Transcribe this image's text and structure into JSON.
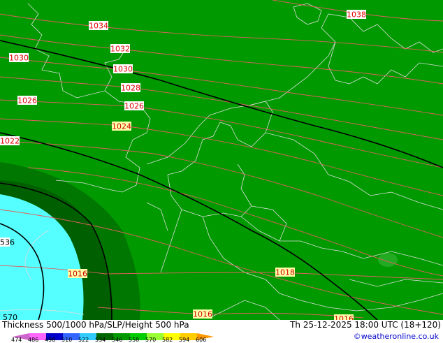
{
  "map": {
    "isobar_labels": [
      {
        "text": "1038"
      },
      {
        "text": "1034"
      },
      {
        "text": "1032"
      },
      {
        "text": "1030"
      },
      {
        "text": "1030"
      },
      {
        "text": "1028"
      },
      {
        "text": "1026"
      },
      {
        "text": "1026"
      },
      {
        "text": "1024"
      },
      {
        "text": "1022"
      },
      {
        "text": "1018"
      },
      {
        "text": "1016"
      },
      {
        "text": "1016"
      },
      {
        "text": "1016"
      }
    ],
    "thickness_labels": [
      "536",
      "570"
    ],
    "colors": {
      "land_green": "#009a00",
      "dark_green": "#007700",
      "darker_green": "#005f00",
      "cyan": "#55ffff",
      "isobar": "#e06060",
      "border": "#dddddd",
      "height_line": "#000000"
    }
  },
  "footer": {
    "title": "Thickness 500/1000 hPa/SLP/Height 500 hPa",
    "datetime": "Th 25-12-2025 18:00 UTC (18+120)",
    "credit": "©weatheronline.co.uk",
    "scale": {
      "labels": [
        "474",
        "486",
        "498",
        "510",
        "522",
        "534",
        "546",
        "558",
        "570",
        "582",
        "594",
        "606"
      ],
      "colors": [
        "#cc66cc",
        "#ff66ff",
        "#0000cc",
        "#3366ff",
        "#33ccff",
        "#006600",
        "#009900",
        "#00cc00",
        "#99ff33",
        "#ffff00",
        "#ffcc00",
        "#ff9900"
      ]
    }
  }
}
